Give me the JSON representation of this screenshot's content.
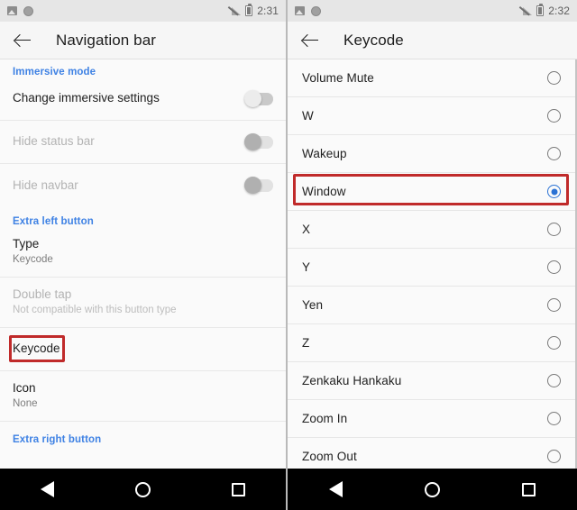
{
  "left_phone": {
    "statusbar": {
      "icons": [
        "photo-icon",
        "circle-icon",
        "signal-off-icon",
        "battery-icon"
      ],
      "time": "2:31"
    },
    "actionbar": {
      "back_icon": "back-arrow-icon",
      "title": "Navigation bar"
    },
    "section_header": "Immersive mode",
    "rows": [
      {
        "title": "Change immersive settings",
        "sub": "",
        "control": "toggle-off",
        "disabled": false
      },
      {
        "title": "Hide status bar",
        "sub": "",
        "control": "toggle-off-gray",
        "disabled": true
      },
      {
        "title": "Hide navbar",
        "sub": "",
        "control": "toggle-off-gray",
        "disabled": true
      }
    ],
    "section_header_2": "Extra left button",
    "rows2": [
      {
        "title": "Type",
        "sub": "Keycode",
        "disabled": false
      },
      {
        "title": "Double tap",
        "sub": "Not compatible with this button type",
        "disabled": true
      },
      {
        "title": "Keycode",
        "sub": "",
        "disabled": false,
        "highlighted": true
      },
      {
        "title": "Icon",
        "sub": "None",
        "disabled": false
      }
    ],
    "section_header_3": "Extra right button",
    "navbar": {
      "back": "nav-back-icon",
      "home": "nav-home-icon",
      "recents": "nav-recents-icon"
    }
  },
  "right_phone": {
    "statusbar": {
      "icons": [
        "photo-icon",
        "circle-icon",
        "signal-off-icon",
        "battery-icon"
      ],
      "time": "2:32"
    },
    "actionbar": {
      "back_icon": "back-arrow-icon",
      "title": "Keycode"
    },
    "options": [
      {
        "label": "Volume Mute",
        "selected": false
      },
      {
        "label": "W",
        "selected": false
      },
      {
        "label": "Wakeup",
        "selected": false
      },
      {
        "label": "Window",
        "selected": true
      },
      {
        "label": "X",
        "selected": false
      },
      {
        "label": "Y",
        "selected": false
      },
      {
        "label": "Yen",
        "selected": false
      },
      {
        "label": "Z",
        "selected": false
      },
      {
        "label": "Zenkaku Hankaku",
        "selected": false
      },
      {
        "label": "Zoom In",
        "selected": false
      },
      {
        "label": "Zoom Out",
        "selected": false
      }
    ],
    "navbar": {
      "back": "nav-back-icon",
      "home": "nav-home-icon",
      "recents": "nav-recents-icon"
    }
  },
  "annotations": {
    "highlight_color": "#c02a2a",
    "accent_blue": "#3f82e4",
    "radio_selected_color": "#2b72d4",
    "boxes": [
      {
        "name": "keycode-row-highlight",
        "target": "left.keycode-row"
      },
      {
        "name": "window-row-highlight",
        "target": "right.window-row"
      }
    ]
  }
}
